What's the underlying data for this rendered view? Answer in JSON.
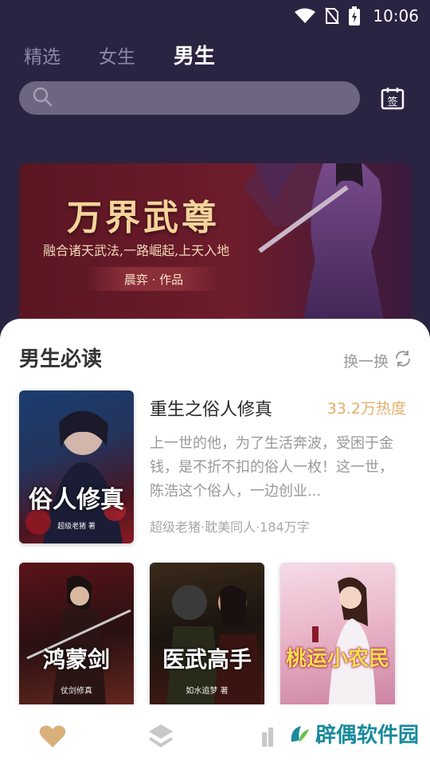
{
  "status": {
    "time": "10:06"
  },
  "tabs": [
    {
      "label": "精选"
    },
    {
      "label": "女生"
    },
    {
      "label": "男生"
    }
  ],
  "search": {
    "placeholder": ""
  },
  "sign_button": {
    "label": "签"
  },
  "banner": {
    "title": "万界武尊",
    "subtitle": "融合诸天武法,一路崛起,上天入地",
    "author": "晨弈 · 作品"
  },
  "section": {
    "title": "男生必读",
    "refresh_label": "换一换"
  },
  "featured": {
    "cover_title": "俗人修真",
    "cover_sub": "超级老猪 著",
    "title": "重生之俗人修真",
    "heat": "33.2万热度",
    "description": "上一世的他，为了生活奔波，受困于金钱，是不折不扣的俗人一枚！这一世，陈浩这个俗人，一边创业...",
    "meta": "超级老猪·耽美同人·184万字"
  },
  "covers": [
    {
      "title": "鸿蒙剑",
      "author": "仗剑修真",
      "publisher": ""
    },
    {
      "title": "医武高手",
      "author": "如水追梦 著",
      "publisher": ""
    },
    {
      "title": "桃运小农民",
      "author": "",
      "publisher": ""
    }
  ],
  "watermark": {
    "text": "辟偶软件园"
  },
  "colors": {
    "header_bg": "#2b2342",
    "accent_heat": "#e0b26a",
    "nav_active": "#d8b07a"
  }
}
